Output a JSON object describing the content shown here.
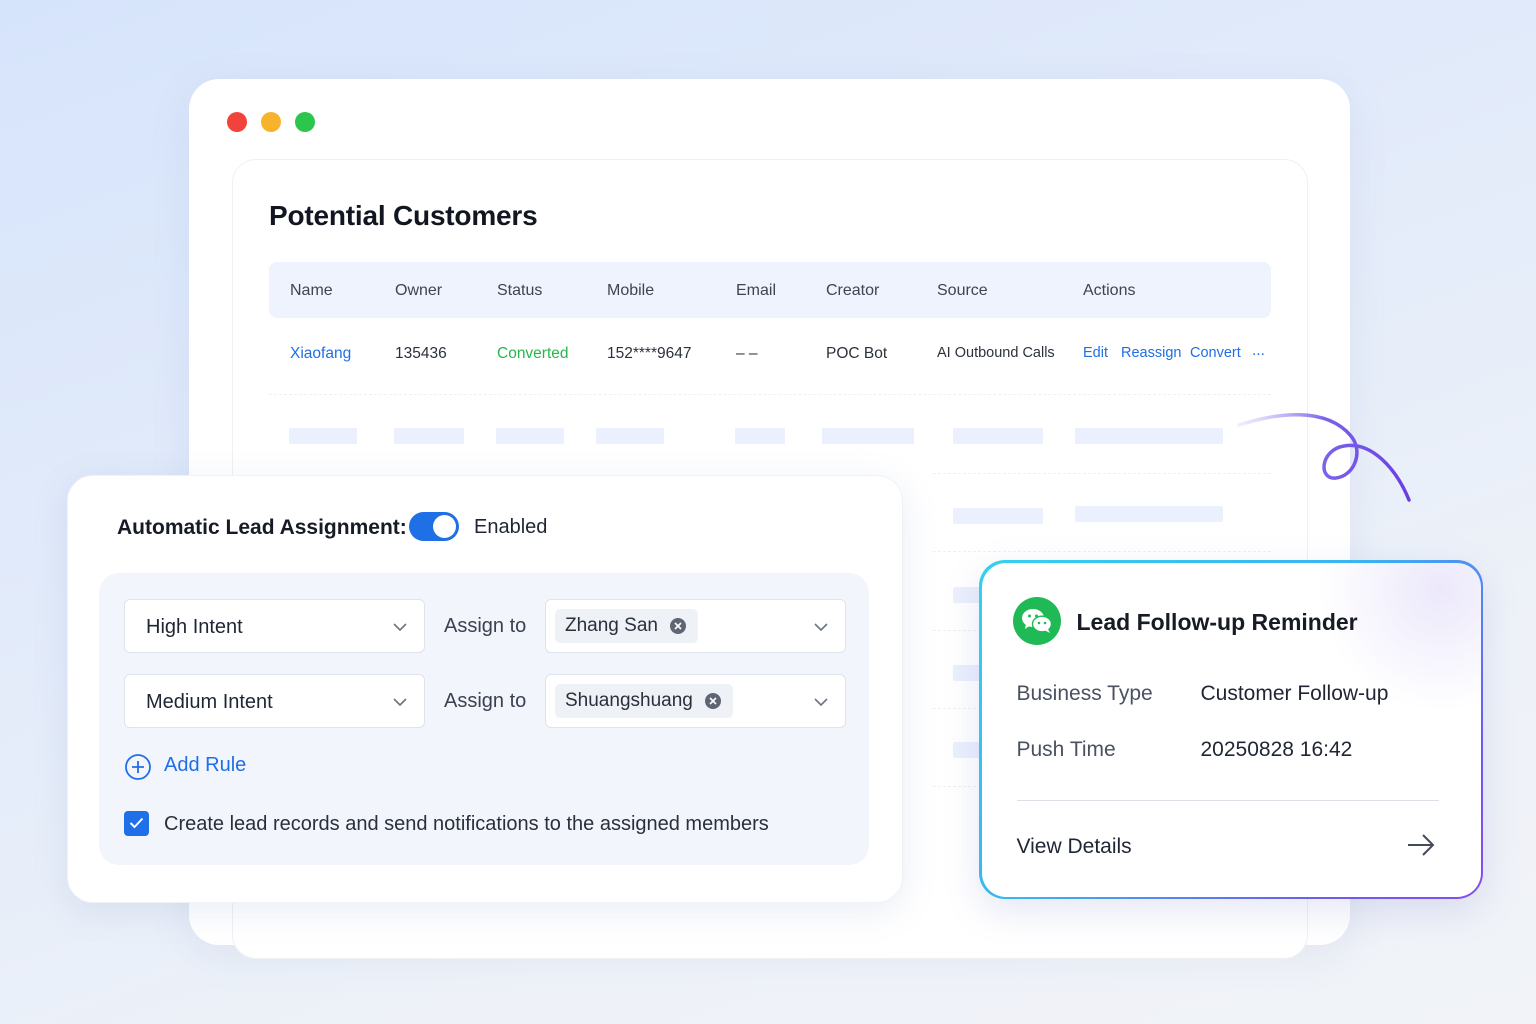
{
  "window": {
    "controls": [
      "close",
      "minimize",
      "maximize"
    ]
  },
  "page_title": "Potential Customers",
  "table": {
    "columns": [
      "Name",
      "Owner",
      "Status",
      "Mobile",
      "Email",
      "Creator",
      "Source",
      "Actions"
    ],
    "rows": [
      {
        "name": "Xiaofang",
        "owner": "135436",
        "status": "Converted",
        "mobile": "152****9647",
        "email": "– –",
        "creator": "POC Bot",
        "source": "AI Outbound Calls",
        "actions": [
          "Edit",
          "Reassign",
          "Convert",
          "..."
        ]
      }
    ]
  },
  "assignment": {
    "title": "Automatic Lead Assignment:",
    "toggle_label": "Enabled",
    "toggle_on": true,
    "rules": [
      {
        "intent": "High Intent",
        "assign_label": "Assign to",
        "assignee": "Zhang San"
      },
      {
        "intent": "Medium Intent",
        "assign_label": "Assign to",
        "assignee": "Shuangshuang"
      }
    ],
    "add_rule_label": "Add Rule",
    "notify_label": "Create lead records and send notifications to the assigned members",
    "notify_checked": true
  },
  "reminder": {
    "title": "Lead Follow-up Reminder",
    "icon": "wechat-icon",
    "fields": [
      {
        "label": "Business Type",
        "value": "Customer Follow-up"
      },
      {
        "label": "Push Time",
        "value": "20250828 16:42"
      }
    ],
    "view_details_label": "View Details"
  },
  "colors": {
    "accent": "#1f6fe6",
    "success": "#28b64a",
    "wechat": "#1fba55",
    "gradient_border_start": "#35d0ef",
    "gradient_border_end": "#8a4cf0"
  }
}
